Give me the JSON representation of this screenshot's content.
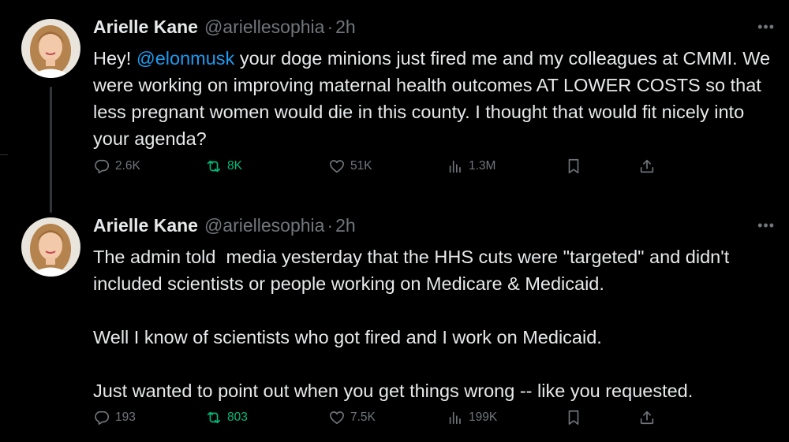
{
  "tweets": [
    {
      "name": "Arielle Kane",
      "handle": "@ariellesophia",
      "separator": "·",
      "time": "2h",
      "text_before": "Hey! ",
      "mention": "@elonmusk",
      "text_after": " your doge minions just fired me and my colleagues at CMMI. We were working on improving maternal health outcomes AT LOWER COSTS so that less pregnant women would die in this county. I thought that would fit nicely into your agenda?",
      "stats": {
        "replies": "2.6K",
        "reposts": "8K",
        "likes": "51K",
        "views": "1.3M"
      }
    },
    {
      "name": "Arielle Kane",
      "handle": "@ariellesophia",
      "separator": "·",
      "time": "2h",
      "text": "The admin told  media yesterday that the HHS cuts were \"targeted\" and didn't included scientists or people working on Medicare & Medicaid.\n\nWell I know of scientists who got fired and I work on Medicaid.\n\nJust wanted to point out when you get things wrong -- like you requested.",
      "stats": {
        "replies": "193",
        "reposts": "803",
        "likes": "7.5K",
        "views": "199K"
      }
    }
  ],
  "icons": {
    "more": "more-icon",
    "reply": "reply-icon",
    "repost": "repost-icon",
    "like": "heart-icon",
    "views": "views-icon",
    "bookmark": "bookmark-icon",
    "share": "share-icon"
  },
  "colors": {
    "background": "#000000",
    "text": "#e7e9ea",
    "muted": "#71767b",
    "link": "#1d9bf0",
    "repost_active": "#00ba7c"
  }
}
